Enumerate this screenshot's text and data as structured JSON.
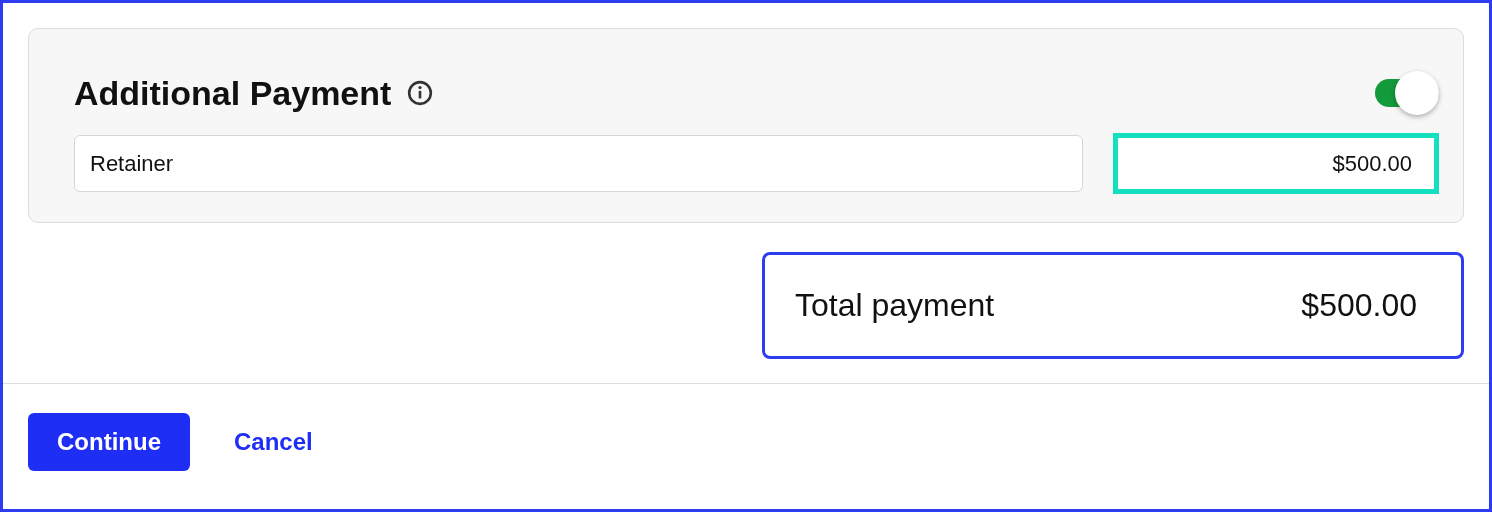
{
  "section": {
    "title": "Additional Payment",
    "enabled": true
  },
  "description_field": {
    "value": "Retainer"
  },
  "amount_field": {
    "value": "$500.00",
    "focused": true
  },
  "total": {
    "label": "Total payment",
    "amount": "$500.00"
  },
  "actions": [
    {
      "kind": "primary",
      "label": "Continue"
    },
    {
      "kind": "link",
      "label": "Cancel"
    }
  ]
}
